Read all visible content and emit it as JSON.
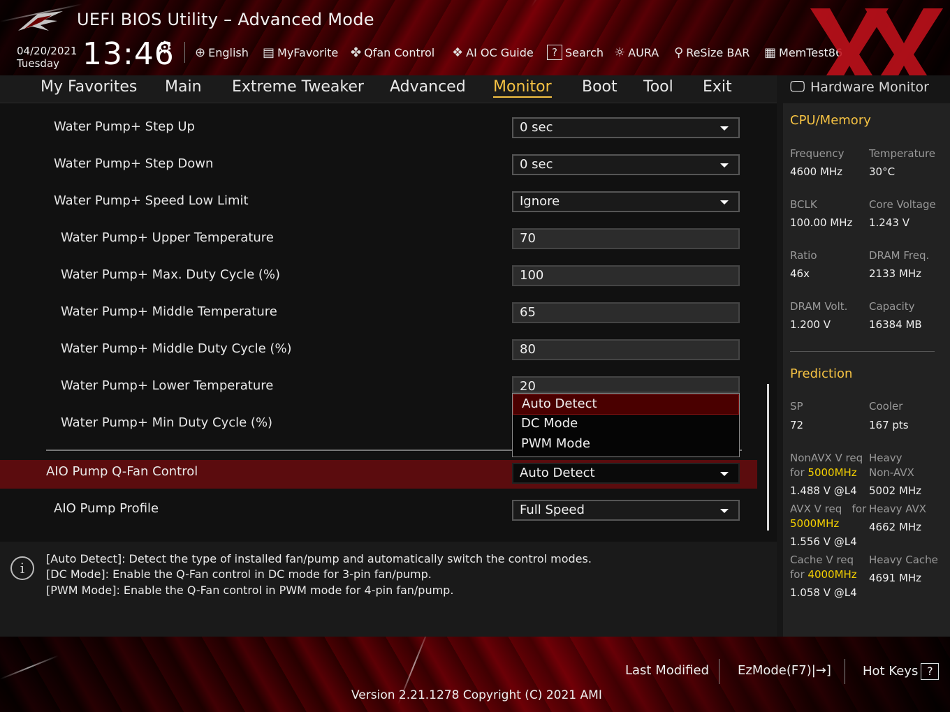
{
  "header": {
    "title": "UEFI BIOS Utility – Advanced Mode",
    "date": "04/20/2021",
    "day": "Tuesday",
    "time": "13:46",
    "toolbar": [
      {
        "id": "language",
        "icon": "globe-icon",
        "label": "English"
      },
      {
        "id": "myfavorite",
        "icon": "list-icon",
        "label": "MyFavorite"
      },
      {
        "id": "qfan",
        "icon": "fan-icon",
        "label": "Qfan Control"
      },
      {
        "id": "aioc",
        "icon": "chip-icon",
        "label": "AI OC Guide"
      },
      {
        "id": "search",
        "icon": "question-icon",
        "label": "Search"
      },
      {
        "id": "aura",
        "icon": "aura-icon",
        "label": "AURA"
      },
      {
        "id": "resizebar",
        "icon": "resize-icon",
        "label": "ReSize BAR"
      },
      {
        "id": "memtest",
        "icon": "memory-icon",
        "label": "MemTest86"
      }
    ]
  },
  "nav": {
    "tabs": [
      "My Favorites",
      "Main",
      "Extreme Tweaker",
      "Advanced",
      "Monitor",
      "Boot",
      "Tool",
      "Exit"
    ],
    "active": "Monitor"
  },
  "settings": [
    {
      "label": "Water Pump+ Step Up",
      "value": "0 sec",
      "kind": "select"
    },
    {
      "label": "Water Pump+ Step Down",
      "value": "0 sec",
      "kind": "select"
    },
    {
      "label": "Water Pump+ Speed Low Limit",
      "value": "Ignore",
      "kind": "select"
    },
    {
      "label": "Water Pump+ Upper Temperature",
      "value": "70",
      "kind": "text"
    },
    {
      "label": "Water Pump+ Max. Duty Cycle (%)",
      "value": "100",
      "kind": "text"
    },
    {
      "label": "Water Pump+ Middle Temperature",
      "value": "65",
      "kind": "text"
    },
    {
      "label": "Water Pump+ Middle Duty Cycle (%)",
      "value": "80",
      "kind": "text"
    },
    {
      "label": "Water Pump+ Lower Temperature",
      "value": "20",
      "kind": "text"
    },
    {
      "label": "Water Pump+ Min Duty Cycle (%)",
      "value": "",
      "kind": "text"
    },
    {
      "label": "AIO Pump Q-Fan Control",
      "value": "Auto Detect",
      "kind": "select"
    },
    {
      "label": "AIO Pump Profile",
      "value": "Full Speed",
      "kind": "select"
    }
  ],
  "dropdown": {
    "options": [
      "Auto Detect",
      "DC Mode",
      "PWM Mode"
    ],
    "selected": "Auto Detect"
  },
  "help": [
    "[Auto Detect]: Detect the type of installed fan/pump and automatically switch the control modes.",
    "[DC Mode]: Enable the Q-Fan control in DC mode for 3-pin fan/pump.",
    "[PWM Mode]: Enable the Q-Fan control in PWM mode for 4-pin fan/pump."
  ],
  "hw_monitor": {
    "title": "Hardware Monitor",
    "cpu_memory": {
      "heading": "CPU/Memory",
      "rows": [
        [
          {
            "label": "Frequency",
            "value": "4600 MHz"
          },
          {
            "label": "Temperature",
            "value": "30°C"
          }
        ],
        [
          {
            "label": "BCLK",
            "value": "100.00 MHz"
          },
          {
            "label": "Core Voltage",
            "value": "1.243 V"
          }
        ],
        [
          {
            "label": "Ratio",
            "value": "46x"
          },
          {
            "label": "DRAM Freq.",
            "value": "2133 MHz"
          }
        ],
        [
          {
            "label": "DRAM Volt.",
            "value": "1.200 V"
          },
          {
            "label": "Capacity",
            "value": "16384 MB"
          }
        ]
      ]
    },
    "prediction": {
      "heading": "Prediction",
      "sp_label": "SP",
      "sp_value": "72",
      "cooler_label": "Cooler",
      "cooler_value": "167 pts",
      "nonavx_label": "NonAVX V req",
      "nonavx_for": "for",
      "nonavx_freq": "5000MHz",
      "nonavx_value": "1.488 V @L4",
      "heavy_nonavx_label_1": "Heavy",
      "heavy_nonavx_label_2": "Non-AVX",
      "heavy_nonavx_value": "5002 MHz",
      "avx_label": "AVX V req",
      "avx_for": "for",
      "avx_freq": "5000MHz",
      "avx_value": "1.556 V @L4",
      "heavy_avx_label": "Heavy AVX",
      "heavy_avx_value": "4662 MHz",
      "cache_label": "Cache V req",
      "cache_for": "for",
      "cache_freq": "4000MHz",
      "cache_value": "1.058 V @L4",
      "heavy_cache_label": "Heavy Cache",
      "heavy_cache_value": "4691 MHz"
    }
  },
  "footer": {
    "last_modified": "Last Modified",
    "ezmode": "EzMode(F7)|",
    "ezmode_icon": "→]",
    "hotkeys": "Hot Keys",
    "hotkeys_icon": "?",
    "version": "Version 2.21.1278 Copyright (C) 2021 AMI"
  },
  "colors": {
    "accent": "#f5c243",
    "highlight_row": "#5b0c0e",
    "dropdown_selected": "#4a0000"
  }
}
